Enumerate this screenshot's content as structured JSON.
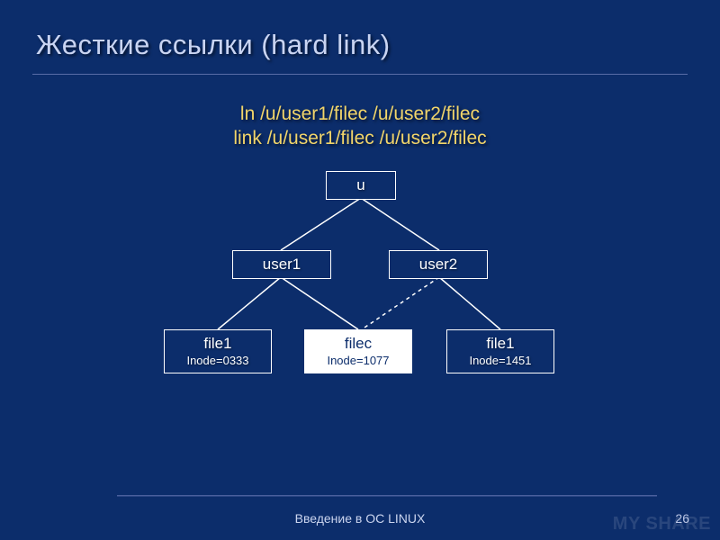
{
  "title": "Жесткие ссылки (hard link)",
  "commands": {
    "line1": "ln /u/user1/filec /u/user2/filec",
    "line2": "link /u/user1/filec /u/user2/filec"
  },
  "tree": {
    "root": {
      "label": "u"
    },
    "level1": [
      {
        "label": "user1"
      },
      {
        "label": "user2"
      }
    ],
    "leaves": [
      {
        "label": "file1",
        "inode": "Inode=0333",
        "highlight": false
      },
      {
        "label": "filec",
        "inode": "Inode=1077",
        "highlight": true
      },
      {
        "label": "file1",
        "inode": "Inode=1451",
        "highlight": false
      }
    ]
  },
  "footer": "Введение в ОС LINUX",
  "page_number": "26",
  "watermark": "MY SHARE"
}
